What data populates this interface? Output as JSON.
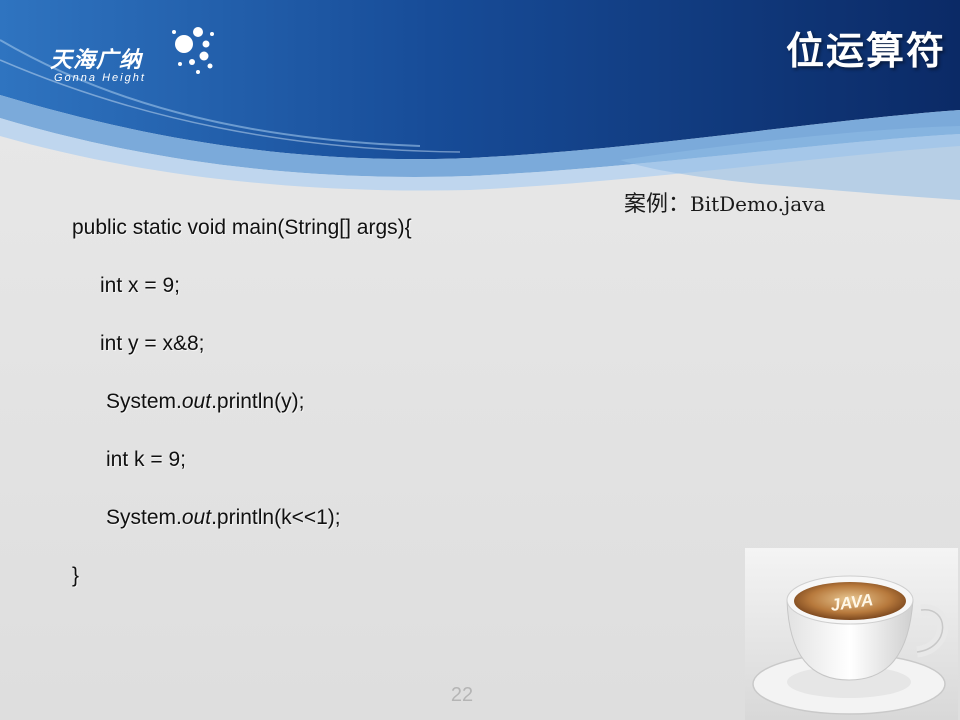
{
  "logo": {
    "cn": "天海广纳",
    "en": "Gonna Height"
  },
  "title": "位运算符",
  "case": {
    "label": "案例：",
    "file": "BitDemo.java"
  },
  "code": {
    "line1": "public static void main(String[] args){",
    "line2": "int x = 9;",
    "line3": "int y = x&8;",
    "line4_pre": "System.",
    "line4_italic": "out",
    "line4_post": ".println(y);",
    "line5": "int k = 9;",
    "line6_pre": "System.",
    "line6_italic": "out",
    "line6_post": ".println(k<<1);",
    "line7": "}"
  },
  "photo": {
    "cup_text": "JAVA"
  },
  "page_number": "22",
  "colors": {
    "header_dark": "#0c2f6e",
    "header_mid": "#1c5aa8",
    "wave_light": "#7eb0de",
    "background": "#e3e3e3"
  }
}
